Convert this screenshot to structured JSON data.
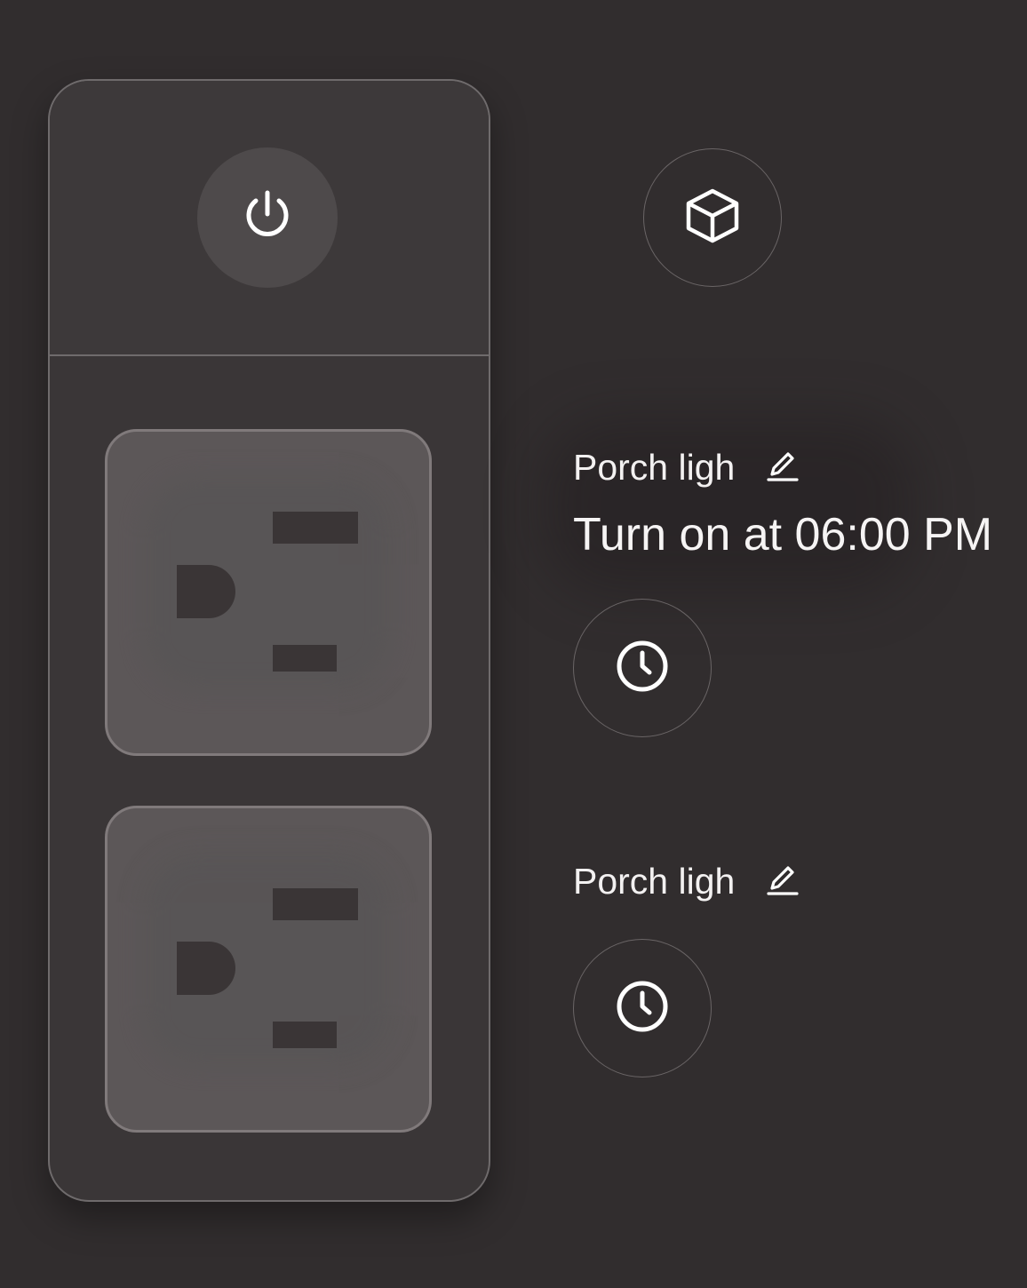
{
  "plugs": [
    {
      "name": "Porch ligh",
      "schedule_text": "Turn on at 06:00 PM"
    },
    {
      "name": "Porch ligh",
      "schedule_text": ""
    }
  ],
  "icons": {
    "power": "power-icon",
    "cube": "cube-icon",
    "edit": "pencil-icon",
    "timer": "clock-icon"
  },
  "colors": {
    "background": "#312d2e",
    "strip": "#3a3637",
    "outlet": "#5c5758",
    "text": "#ffffff"
  }
}
